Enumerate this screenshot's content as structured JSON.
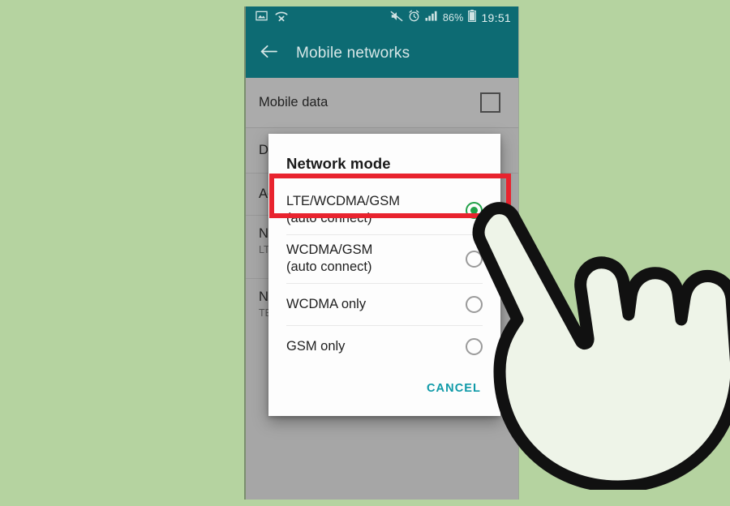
{
  "statusbar": {
    "left_icons": [
      "image-icon",
      "missed-call-icon"
    ],
    "right_icons": [
      "sound-mute-icon",
      "alarm-clock-icon",
      "signal-bars-icon"
    ],
    "battery_percent": "86%",
    "battery_icon": "battery-icon",
    "time": "19:51"
  },
  "appbar": {
    "back_icon": "back-arrow-icon",
    "title": "Mobile networks"
  },
  "settings_list": [
    {
      "label": "Mobile data",
      "sub": "",
      "control": "checkbox",
      "checked": false
    },
    {
      "label": "Data roaming",
      "sub": "",
      "control": "checkbox",
      "checked": false
    },
    {
      "label": "Access Point Names",
      "sub": "",
      "control": "none",
      "checked": false
    },
    {
      "label": "Network mode",
      "sub": "LTE/WCDMA/GSM\n(auto connect)",
      "control": "none",
      "checked": false
    },
    {
      "label": "Network operators",
      "sub": "TELUS",
      "control": "none",
      "checked": false
    }
  ],
  "dialog": {
    "title": "Network mode",
    "options": [
      {
        "text": "LTE/WCDMA/GSM\n(auto connect)",
        "selected": true
      },
      {
        "text": "WCDMA/GSM\n(auto connect)",
        "selected": false
      },
      {
        "text": "WCDMA only",
        "selected": false
      },
      {
        "text": "GSM only",
        "selected": false
      }
    ],
    "cancel_label": "CANCEL"
  },
  "annotation": {
    "highlight_color": "#e8232e",
    "highlight_target": "LTE/WCDMA/GSM (auto connect)"
  },
  "colors": {
    "page_background": "#b5d3a0",
    "status_bar": "#0d6b73",
    "app_bar": "#0d6b73",
    "list_background": "#b3b3b3",
    "dialog_background": "#fdfdfd",
    "accent_radio": "#21a148",
    "accent_action": "#0f9aa8"
  }
}
